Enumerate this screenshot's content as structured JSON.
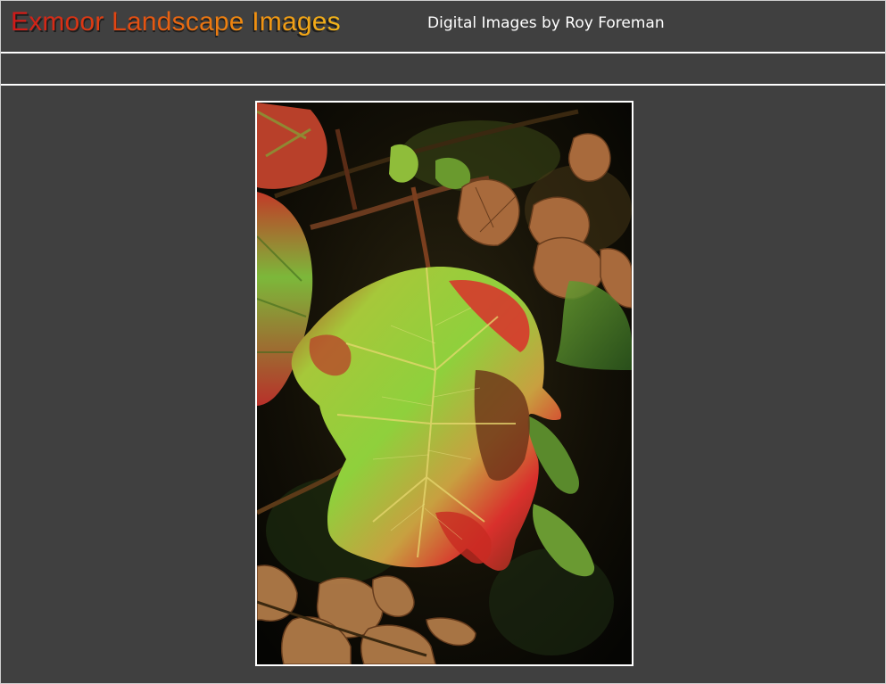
{
  "header": {
    "site_title": "Exmoor Landscape Images",
    "subtitle": "Digital Images by Roy Foreman"
  },
  "photo": {
    "alt": "Autumn oak-leaf hydrangea leaf",
    "colors": {
      "leaf_green": "#8fce3a",
      "leaf_red": "#d9302c",
      "leaf_brown": "#7a3a1a",
      "dried_leaf": "#b07040",
      "background": "#0d0d06"
    }
  }
}
